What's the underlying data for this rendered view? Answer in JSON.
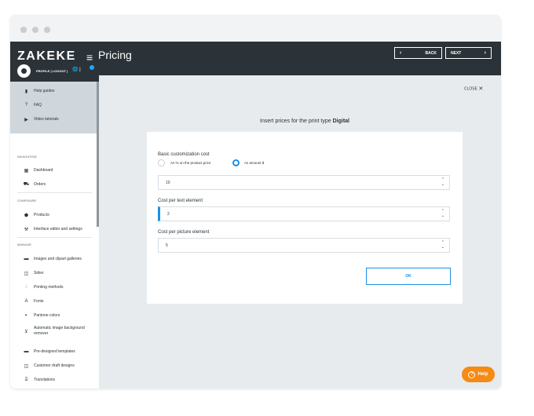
{
  "app": {
    "logo": "ZAKEKE",
    "page_title": "Pricing"
  },
  "toolbar": {
    "back_label": "BACK",
    "next_label": "NEXT",
    "back_arrow": "‹",
    "next_arrow": "›"
  },
  "profile": {
    "links": "PROFILE | LOGOUT |",
    "icons": "🌐 |"
  },
  "sidebar": {
    "help_items": [
      {
        "label": "Help guides",
        "icon": "book-icon",
        "glyph": "▮"
      },
      {
        "label": "FAQ",
        "icon": "question-icon",
        "glyph": "?"
      },
      {
        "label": "Video tutorials",
        "icon": "video-icon",
        "glyph": "▶"
      }
    ],
    "sections": [
      {
        "title": "NAVIGATION",
        "items": [
          {
            "label": "Dashboard",
            "icon": "dashboard-icon",
            "glyph": "▦"
          },
          {
            "label": "Orders",
            "icon": "cart-icon",
            "glyph": "⛟"
          }
        ]
      },
      {
        "title": "CONFIGURE",
        "items": [
          {
            "label": "Products",
            "icon": "products-icon",
            "glyph": "⬟"
          },
          {
            "label": "Interface editor and settings",
            "icon": "settings-icon",
            "glyph": "⚒"
          }
        ]
      },
      {
        "title": "MANAGE",
        "items": [
          {
            "label": "Images and clipart galleries",
            "icon": "image-icon",
            "glyph": "▬"
          },
          {
            "label": "Sides",
            "icon": "sides-icon",
            "glyph": "◫"
          },
          {
            "label": "Printing methods",
            "icon": "printing-icon",
            "glyph": "◌"
          },
          {
            "label": "Fonts",
            "icon": "fonts-icon",
            "glyph": "A"
          },
          {
            "label": "Pantone colors",
            "icon": "palette-icon",
            "glyph": "◐"
          },
          {
            "label": "Automatic image background remover",
            "icon": "bg-remover-icon",
            "glyph": "⊻"
          },
          {
            "label": "Pre-designed templates",
            "icon": "templates-icon",
            "glyph": "▬"
          },
          {
            "label": "Customer draft designs",
            "icon": "drafts-icon",
            "glyph": "◫"
          },
          {
            "label": "Translations",
            "icon": "translate-icon",
            "glyph": "⌸"
          }
        ]
      }
    ]
  },
  "main": {
    "close_label": "CLOSE",
    "heading_prefix": "Insert prices for the print type",
    "print_type": "Digital",
    "form": {
      "basic_label": "Basic customization cost",
      "radio_percent_label": "As % on the product price",
      "radio_amount_label": "As amount $",
      "selected_radio": "As amount $",
      "basic_value": "10",
      "text_label": "Cost per text element",
      "text_value": "2",
      "picture_label": "Cost per picture element",
      "picture_value": "5",
      "ok_label": "OK"
    }
  },
  "help_button": {
    "label": "Help",
    "glyph": "?"
  },
  "colors": {
    "accent": "#1c8fe6",
    "topbar": "#2b3338",
    "help": "#f58a14",
    "background": "#e7ebee"
  }
}
